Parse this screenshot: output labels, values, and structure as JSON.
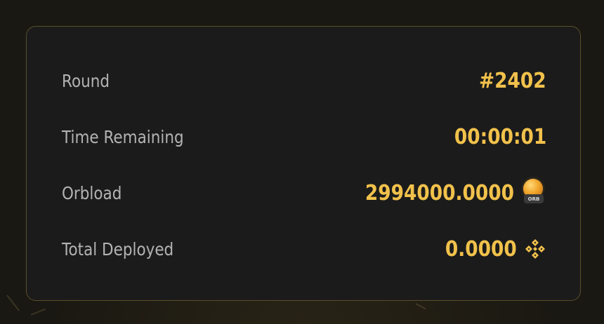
{
  "stats": {
    "round": {
      "label": "Round",
      "value": "#2402"
    },
    "time_remaining": {
      "label": "Time Remaining",
      "value": "00:00:01"
    },
    "orbload": {
      "label": "Orbload",
      "value": "2994000.0000",
      "icon": "orb-token-icon",
      "icon_text": "ORB"
    },
    "total_deployed": {
      "label": "Total Deployed",
      "value": "0.0000",
      "icon": "bnb-icon"
    }
  },
  "colors": {
    "accent": "#f1c14b",
    "label": "#b3b3b3",
    "panel_bg": "#1b1b1b",
    "panel_border": "#5a4e2a",
    "page_bg": "#1a1812"
  }
}
